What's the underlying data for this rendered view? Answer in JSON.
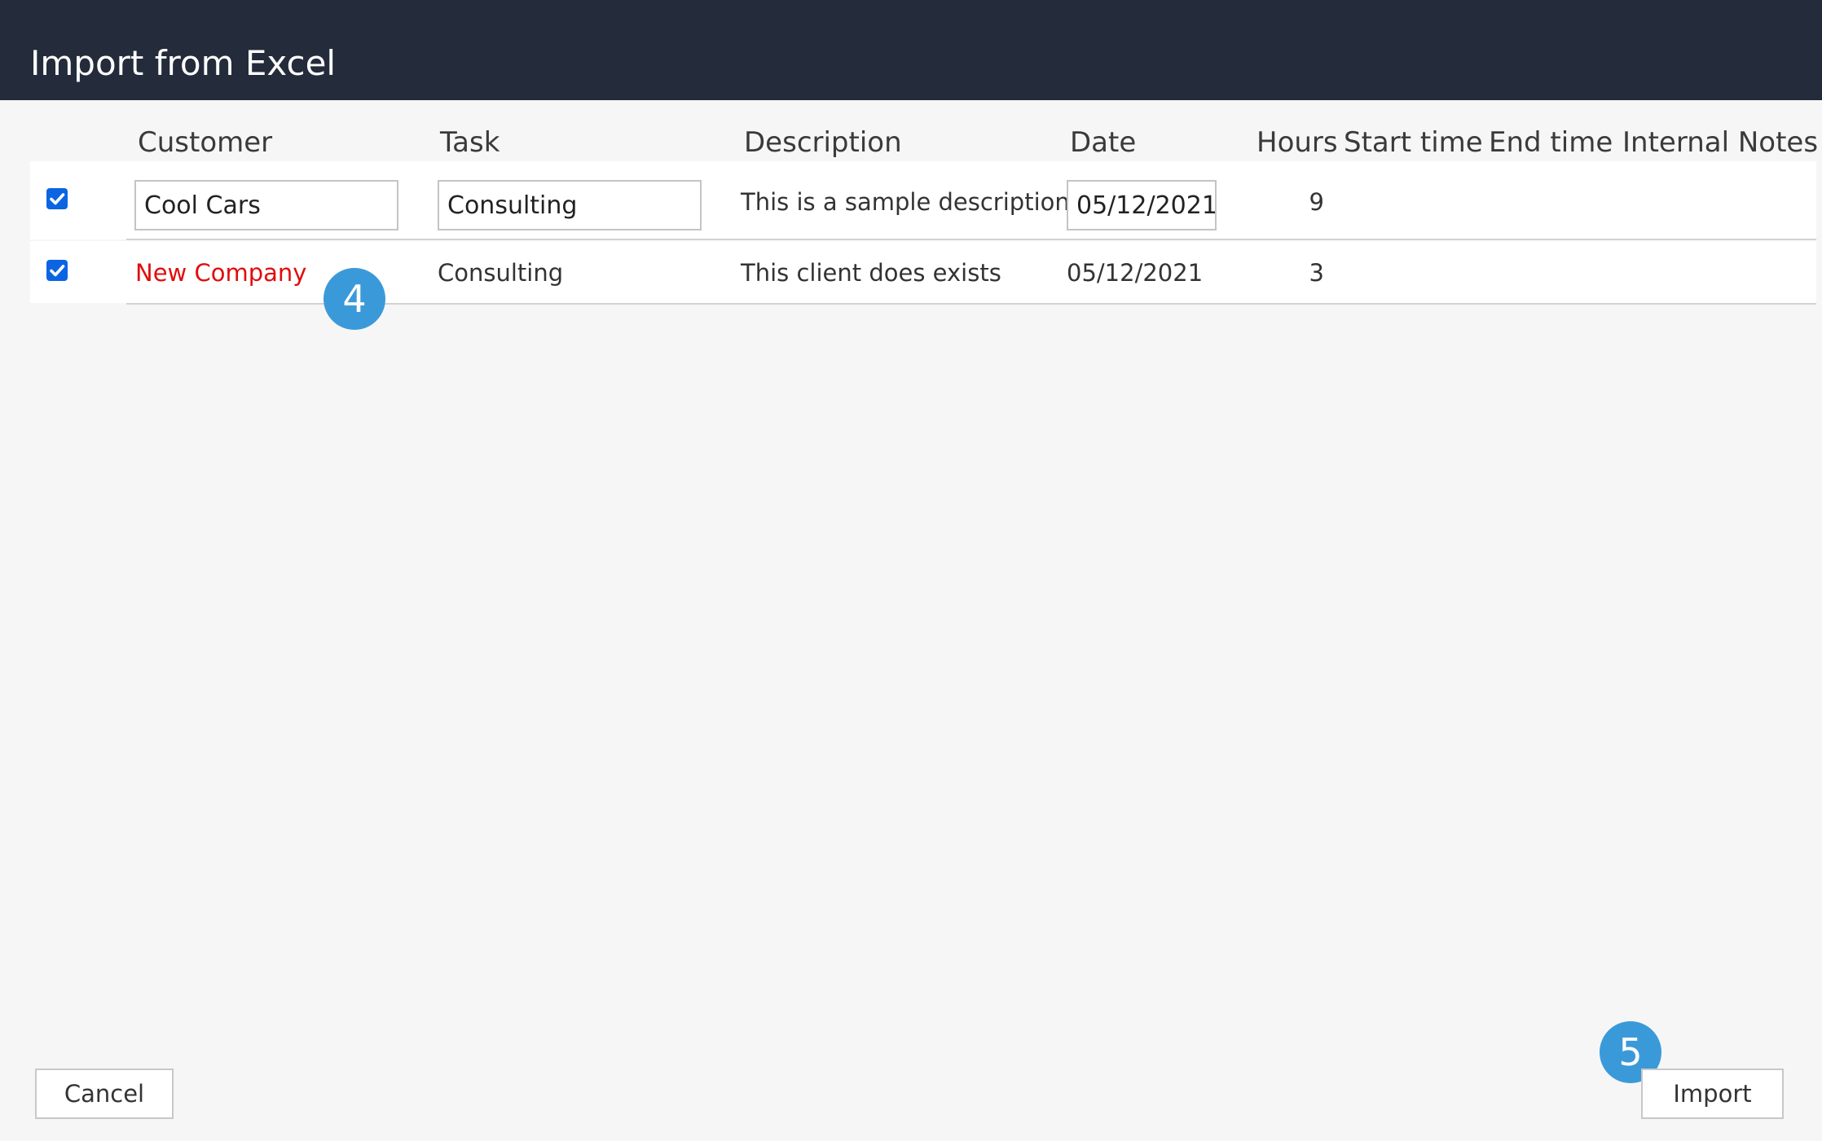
{
  "window": {
    "title": "Import from Excel"
  },
  "table": {
    "columns": [
      "Customer",
      "Task",
      "Description",
      "Date",
      "Hours",
      "Start time",
      "End time",
      "Internal Notes"
    ],
    "rows": [
      {
        "selected": true,
        "customer": "Cool Cars",
        "task": "Consulting",
        "description": "This is a sample description",
        "date": "05/12/2021",
        "hours": "9"
      },
      {
        "selected": true,
        "customer": "New Company",
        "task": "Consulting",
        "description": "This client does exists",
        "date": "05/12/2021",
        "hours": "3"
      }
    ]
  },
  "annotations": {
    "step_4": "4",
    "step_5": "5"
  },
  "footer": {
    "cancel_label": "Cancel",
    "import_label": "Import"
  },
  "colors": {
    "header_bg": "#242b3a",
    "checkbox": "#0b65e3",
    "error_text": "#e10d0d",
    "badge": "#3a9ad9"
  }
}
